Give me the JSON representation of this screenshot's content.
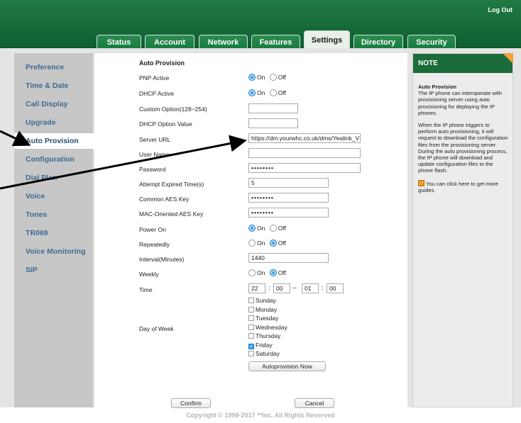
{
  "header": {
    "logout_label": "Log Out",
    "tabs": [
      "Status",
      "Account",
      "Network",
      "Features",
      "Settings",
      "Directory",
      "Security"
    ],
    "active_tab": "Settings"
  },
  "sidebar": {
    "items": [
      "Preference",
      "Time & Date",
      "Call Display",
      "Upgrade",
      "Auto Provision",
      "Configuration",
      "Dial Plan",
      "Voice",
      "Tones",
      "TR069",
      "Voice Monitoring",
      "SIP"
    ],
    "active": "Auto Provision"
  },
  "form": {
    "title": "Auto Provision",
    "on_label": "On",
    "off_label": "Off",
    "pnp_active": {
      "label": "PNP Active",
      "value": "On"
    },
    "dhcp_active": {
      "label": "DHCP Active",
      "value": "On"
    },
    "custom_option": {
      "label": "Custom Option(128~254)",
      "value": ""
    },
    "dhcp_option_value": {
      "label": "DHCP Option Value",
      "value": ""
    },
    "server_url": {
      "label": "Server URL",
      "value": "https://dm.yourwhc.co.uk/dms/Yealink_V"
    },
    "user_name": {
      "label": "User Name",
      "value": ""
    },
    "password": {
      "label": "Password",
      "value": "••••••••"
    },
    "attempt_expired": {
      "label": "Attempt Expired Time(s)",
      "value": "5"
    },
    "common_aes": {
      "label": "Common AES Key",
      "value": "••••••••"
    },
    "mac_aes": {
      "label": "MAC-Oriented AES Key",
      "value": "••••••••"
    },
    "power_on": {
      "label": "Power On",
      "value": "On"
    },
    "repeatedly": {
      "label": "Repeatedly",
      "value": "Off"
    },
    "interval": {
      "label": "Interval(Minutes)",
      "value": "1440"
    },
    "weekly": {
      "label": "Weekly",
      "value": "Off"
    },
    "time": {
      "label": "Time",
      "start_hour": "22",
      "start_min": "00",
      "end_hour": "01",
      "end_min": "00",
      "colon": ":",
      "dash": "--"
    },
    "day_of_week": {
      "label": "Day of Week",
      "days": [
        {
          "name": "Sunday",
          "checked": false
        },
        {
          "name": "Monday",
          "checked": false
        },
        {
          "name": "Tuesday",
          "checked": false
        },
        {
          "name": "Wednesday",
          "checked": false
        },
        {
          "name": "Thursday",
          "checked": false
        },
        {
          "name": "Friday",
          "checked": true
        },
        {
          "name": "Saturday",
          "checked": false
        }
      ]
    },
    "autoprovision_now_label": "Autoprovision Now",
    "confirm_label": "Confirm",
    "cancel_label": "Cancel"
  },
  "note": {
    "header": "NOTE",
    "title": "Auto Provision",
    "para1": "The IP phone can interoperate with provisioning server using auto provisioning for deploying the IP phones.",
    "para2": "When the IP phone triggers to perform auto provisioning, it will request to download the configuration files from the provisioning server. During the auto provisioning process, the IP phone will download and update configuration files to the phone flash.",
    "guide_text": "You can click here to get more guides."
  },
  "footer": {
    "copyright": "Copyright © 1998-2017 **Inc. All Rights Reserved"
  },
  "colors": {
    "header_green": "#1f7a44",
    "radio_on": "#3d9ee6",
    "note_corner": "#f3a33a",
    "sidebar_link": "#3e6b93"
  }
}
